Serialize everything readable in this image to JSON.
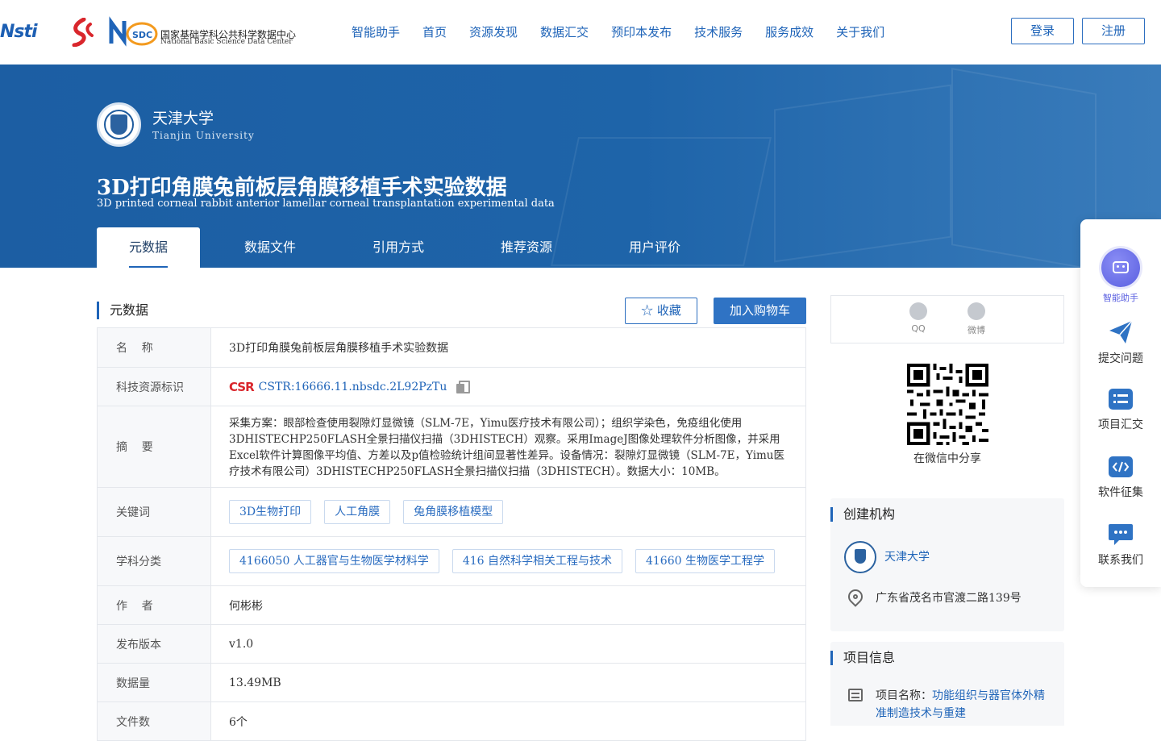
{
  "header": {
    "logo_cstr": "Nsti",
    "logo_nsdc_cn": "国家基础学科公共科学数据中心",
    "logo_nsdc_en": "National Basic Science Data Center",
    "logo_nsdc_badge": "SDC",
    "nav": [
      "智能助手",
      "首页",
      "资源发现",
      "数据汇交",
      "预印本发布",
      "技术服务",
      "服务成效",
      "关于我们"
    ],
    "login": "登录",
    "register": "注册"
  },
  "banner": {
    "org_name": "天津大学",
    "org_name_en": "Tianjin University",
    "title_cn": "3D打印角膜兔前板层角膜移植手术实验数据",
    "title_en": "3D printed corneal rabbit anterior lamellar corneal transplantation experimental data",
    "tabs": [
      "元数据",
      "数据文件",
      "引用方式",
      "推荐资源",
      "用户评价"
    ]
  },
  "metadata": {
    "section_title": "元数据",
    "favorite": "收藏",
    "add_cart": "加入购物车",
    "name_label": "名    称",
    "name_value": "3D打印角膜兔前板层角膜移植手术实验数据",
    "cstr_label": "科技资源标识",
    "cstr_badge": "CSR",
    "cstr_value": "CSTR:16666.11.nbsdc.2L92PzTu",
    "abstract_label": "摘    要",
    "abstract_value": "采集方案：眼部检查使用裂隙灯显微镜（SLM-7E，Yimu医疗技术有限公司）；组织学染色，免疫组化使用3DHISTECHP250FLASH全景扫描仪扫描（3DHISTECH）观察。采用ImageJ图像处理软件分析图像，并采用Excel软件计算图像平均值、方差以及p值检验统计组间显著性差异。设备情况：裂隙灯显微镜（SLM-7E，Yimu医疗技术有限公司）3DHISTECHP250FLASH全景扫描仪扫描（3DHISTECH）。数据大小：10MB。",
    "keywords_label": "关键词",
    "keywords": [
      "3D生物打印",
      "人工角膜",
      "兔角膜移植模型"
    ],
    "subject_label": "学科分类",
    "subjects": [
      "4166050 人工器官与生物医学材料学",
      "416 自然科学相关工程与技术",
      "41660 生物医学工程学"
    ],
    "author_label": "作    者",
    "author_value": "何彬彬",
    "version_label": "发布版本",
    "version_value": "v1.0",
    "size_label": "数据量",
    "size_value": "13.49MB",
    "files_label": "文件数",
    "files_value": "6个"
  },
  "share": {
    "qq": "QQ",
    "weibo": "微博",
    "qr_caption": "在微信中分享"
  },
  "creator": {
    "title": "创建机构",
    "org": "天津大学",
    "address": "广东省茂名市官渡二路139号"
  },
  "project": {
    "title": "项目信息",
    "label": "项目名称：",
    "value": "功能组织与器官体外精准制造技术与重建"
  },
  "float_bar": {
    "assistant": "智能助手",
    "submit": "提交问题",
    "project_collect": "项目汇交",
    "software": "软件征集",
    "contact": "联系我们"
  },
  "colors": {
    "primary": "#1f64b8",
    "banner": "#1c5ea3",
    "button": "#2f73c4"
  }
}
